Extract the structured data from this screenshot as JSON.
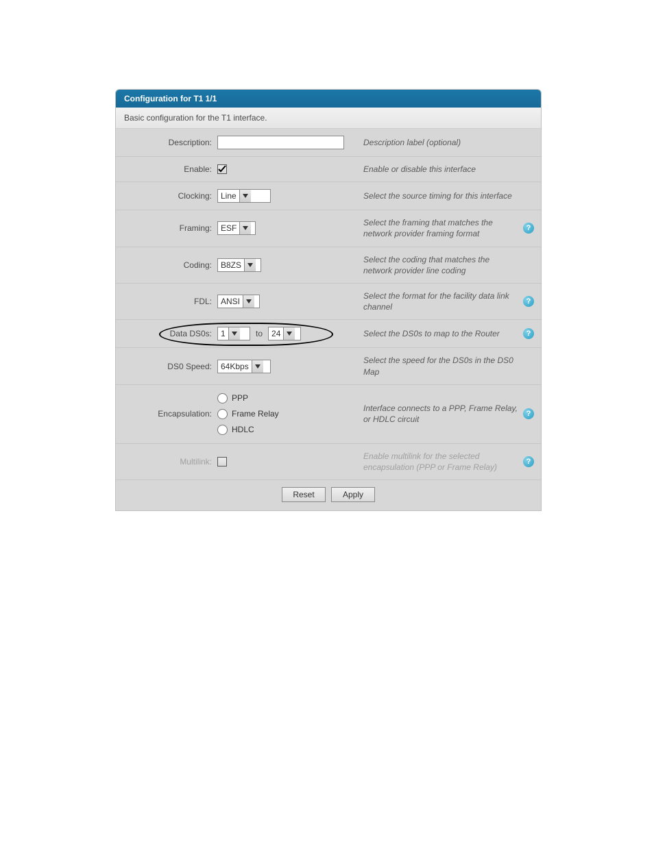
{
  "panel": {
    "title": "Configuration for T1 1/1",
    "subtitle": "Basic configuration for the T1 interface."
  },
  "rows": {
    "description": {
      "label": "Description:",
      "value": "",
      "hint": "Description label (optional)"
    },
    "enable": {
      "label": "Enable:",
      "checked": true,
      "hint": "Enable or disable this interface"
    },
    "clocking": {
      "label": "Clocking:",
      "value": "Line",
      "hint": "Select the source timing for this interface"
    },
    "framing": {
      "label": "Framing:",
      "value": "ESF",
      "hint": "Select the framing that matches the network provider framing format"
    },
    "coding": {
      "label": "Coding:",
      "value": "B8ZS",
      "hint": "Select the coding that matches the network provider line coding"
    },
    "fdl": {
      "label": "FDL:",
      "value": "ANSI",
      "hint": "Select the format for the facility data link channel"
    },
    "data_ds0s": {
      "label": "Data DS0s:",
      "from": "1",
      "sep": "to",
      "to": "24",
      "hint": "Select the DS0s to map to the Router"
    },
    "ds0_speed": {
      "label": "DS0 Speed:",
      "value": "64Kbps",
      "hint": "Select the speed for the DS0s in the DS0 Map"
    },
    "encapsulation": {
      "label": "Encapsulation:",
      "options": [
        "PPP",
        "Frame Relay",
        "HDLC"
      ],
      "hint": "Interface connects to a PPP, Frame Relay, or HDLC circuit"
    },
    "multilink": {
      "label": "Multilink:",
      "checked": false,
      "hint": "Enable multilink for the selected encapsulation (PPP or Frame Relay)"
    }
  },
  "buttons": {
    "reset": "Reset",
    "apply": "Apply"
  },
  "help_glyph": "?"
}
